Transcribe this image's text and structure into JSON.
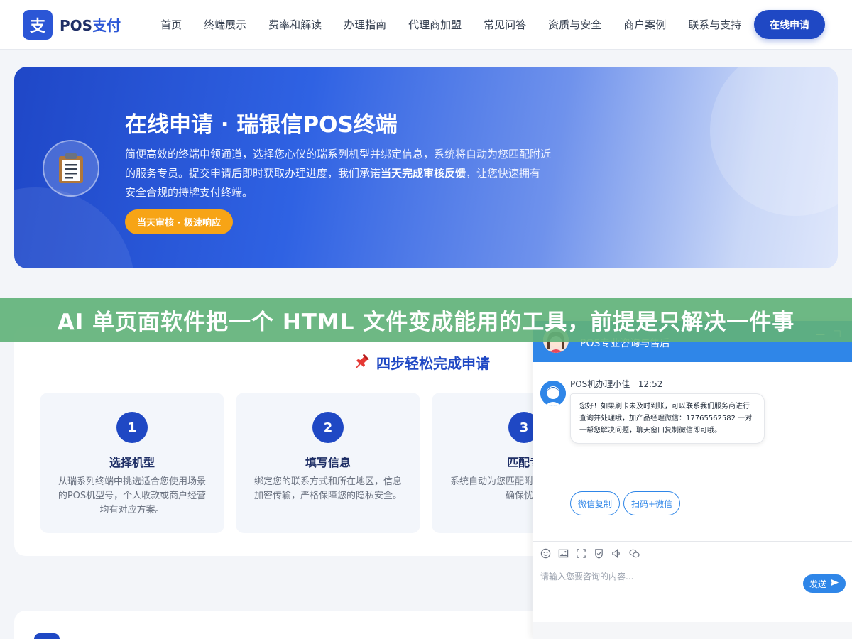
{
  "header": {
    "logo_mark": "支",
    "logo_text_1": "POS",
    "logo_text_2": "支付",
    "nav": [
      "首页",
      "终端展示",
      "费率和解读",
      "办理指南",
      "代理商加盟",
      "常见问答",
      "资质与安全",
      "商户案例",
      "联系与支持"
    ],
    "apply_label": "在线申请"
  },
  "hero": {
    "icon": "clipboard-icon",
    "title": "在线申请 · 瑞银信POS终端",
    "desc_1": "简便高效的终端申领通道，选择您心仪的瑞系列机型并绑定信息，系统将自动为您匹配附近的服务专员。提交申请后即时获取办理进度，我们承诺",
    "desc_bold": "当天完成审核反馈",
    "desc_2": "，让您快速拥有安全合规的持牌支付终端。",
    "badge": "当天审核 · 极速响应"
  },
  "banner": {
    "text": "AI 单页面软件把一个 HTML 文件变成能用的工具，前提是只解决一件事"
  },
  "steps": {
    "title": "四步轻松完成申请",
    "title_icon": "pushpin-icon",
    "items": [
      {
        "num": "1",
        "title": "选择机型",
        "desc": "从瑞系列终端中挑选适合您使用场景的POS机型号，个人收款或商户经营均有对应方案。"
      },
      {
        "num": "2",
        "title": "填写信息",
        "desc": "绑定您的联系方式和所在地区，信息加密传输，严格保障您的隐私安全。"
      },
      {
        "num": "3",
        "title": "匹配专",
        "desc": "系统自动为您匹配附对一专属对接，确保忧。"
      }
    ]
  },
  "chat": {
    "title": "POS专业咨询与售后",
    "minimize": "—",
    "maximize": "☐",
    "agent_name": "POS机办理小佳",
    "time": "12:52",
    "message": "您好！如果刷卡未及时到账，可以联系我们服务商进行查询并处理哦，加产品经理微信：17765562582 一对一帮您解决问题，聊天窗口复制微信即可哦。",
    "quick_replies": [
      "微信复制",
      "扫码+微信"
    ],
    "tools": [
      "emoji-icon",
      "image-icon",
      "screenshot-icon",
      "rating-icon",
      "voice-icon",
      "wechat-icon"
    ],
    "input_placeholder": "请输入您要咨询的内容...",
    "send_label": "发送"
  },
  "colors": {
    "primary": "#1f48c4",
    "chat_blue": "#2f86e8",
    "badge_orange": "#f7a416",
    "banner_green": "#62b279"
  }
}
